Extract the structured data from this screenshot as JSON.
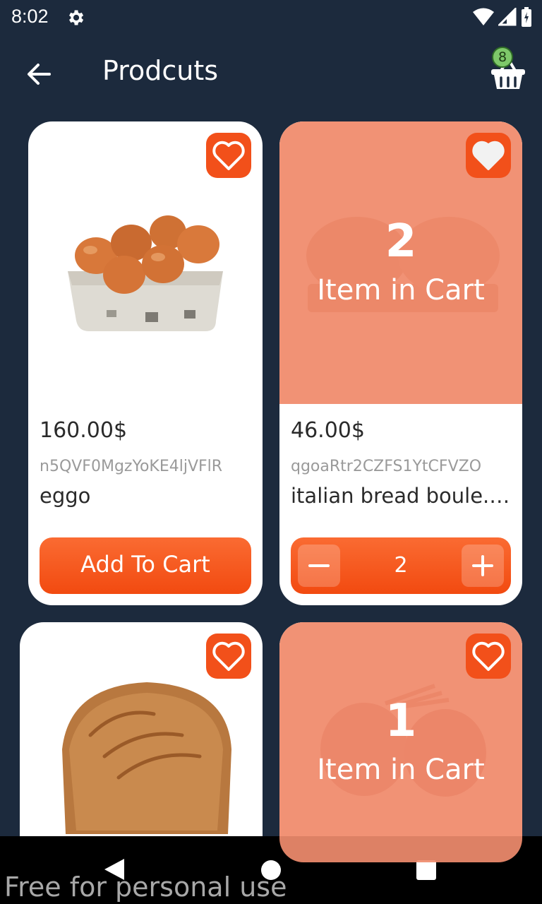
{
  "status_bar": {
    "time": "8:02"
  },
  "app_bar": {
    "title": "Prodcuts",
    "cart_count": "8"
  },
  "products": [
    {
      "price": "160.00$",
      "id": "n5QVF0MgzYoKE4ljVFlR",
      "name": "eggo",
      "action_label": "Add To Cart",
      "image": "eggs-carton"
    },
    {
      "price": "46.00$",
      "id": "qgoaRtr2CZFS1YtCFVZO",
      "name": "italian bread boule.jp...",
      "cart_quantity": "2",
      "overlay_label": "Item in Cart",
      "image": "bread-boules"
    },
    {
      "image": "bread-loaf"
    },
    {
      "cart_quantity": "1",
      "overlay_label": "Item in Cart",
      "image": "beets"
    }
  ],
  "watermark": "Free for personal use",
  "colors": {
    "background": "#1c2a3d",
    "accent": "#f24a10",
    "overlay": "#f08c6e"
  }
}
